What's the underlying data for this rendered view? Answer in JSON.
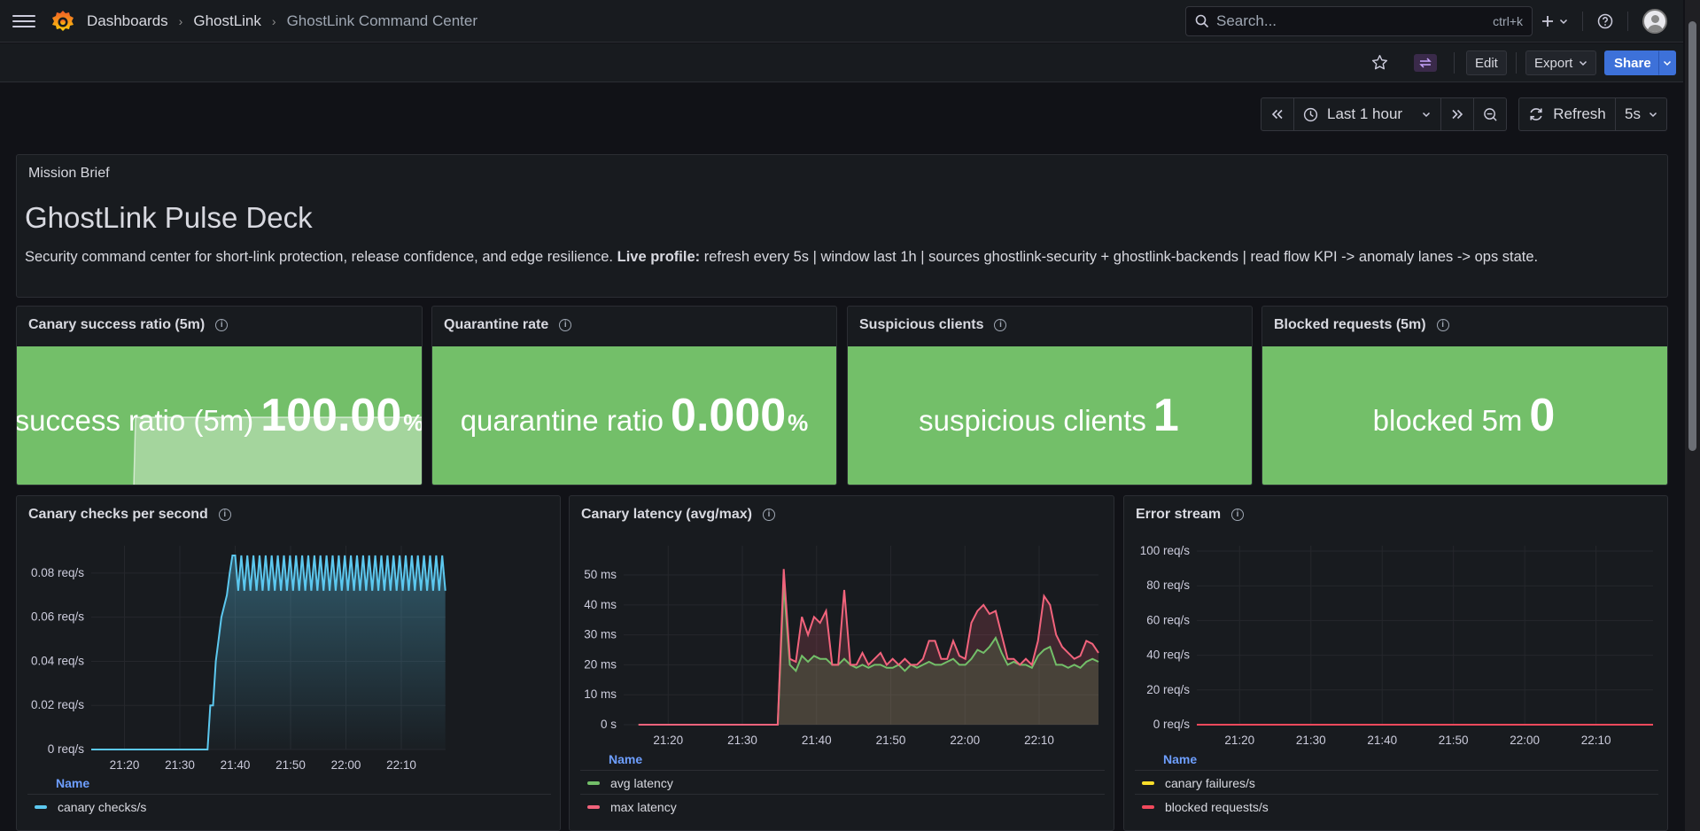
{
  "topbar": {
    "breadcrumbs": [
      "Dashboards",
      "GhostLink",
      "GhostLink Command Center"
    ],
    "search_placeholder": "Search...",
    "search_shortcut": "ctrl+k"
  },
  "toolbar": {
    "edit_label": "Edit",
    "export_label": "Export",
    "share_label": "Share"
  },
  "time_controls": {
    "range_label": "Last 1 hour",
    "refresh_label": "Refresh",
    "interval_label": "5s"
  },
  "mission_brief": {
    "panel_title": "Mission Brief",
    "heading": "GhostLink Pulse Deck",
    "description_start": "Security command center for short-link protection, release confidence, and edge resilience. ",
    "description_bold": "Live profile:",
    "description_end": " refresh every 5s | window last 1h | sources ghostlink-security + ghostlink-backends | read flow KPI -> anomaly lanes -> ops state."
  },
  "stats": [
    {
      "title": "Canary success ratio (5m)",
      "label": "success ratio (5m)",
      "value": "100.00",
      "unit": "%",
      "color": "#73bf69"
    },
    {
      "title": "Quarantine rate",
      "label": "quarantine ratio",
      "value": "0.000",
      "unit": "%",
      "color": "#73bf69"
    },
    {
      "title": "Suspicious clients",
      "label": "suspicious clients",
      "value": "1",
      "unit": "",
      "color": "#73bf69"
    },
    {
      "title": "Blocked requests (5m)",
      "label": "blocked 5m",
      "value": "0",
      "unit": "",
      "color": "#73bf69"
    }
  ],
  "charts": {
    "checks": {
      "title": "Canary checks per second",
      "legend_header": "Name",
      "legend": [
        {
          "name": "canary checks/s",
          "color": "#5cc8ef"
        }
      ]
    },
    "latency": {
      "title": "Canary latency (avg/max)",
      "legend_header": "Name",
      "legend": [
        {
          "name": "avg latency",
          "color": "#73bf69"
        },
        {
          "name": "max latency",
          "color": "#f2637c"
        }
      ]
    },
    "errors": {
      "title": "Error stream",
      "legend_header": "Name",
      "legend": [
        {
          "name": "canary failures/s",
          "color": "#fade2a"
        },
        {
          "name": "blocked requests/s",
          "color": "#f2495c"
        }
      ]
    }
  },
  "chart_data": [
    {
      "type": "line",
      "title": "Canary checks per second",
      "x_ticks": [
        "21:20",
        "21:30",
        "21:40",
        "21:50",
        "22:00",
        "22:10"
      ],
      "y_ticks": [
        "0 req/s",
        "0.02 req/s",
        "0.04 req/s",
        "0.06 req/s",
        "0.08 req/s"
      ],
      "ylim": [
        0,
        0.09
      ],
      "series": [
        {
          "name": "canary checks/s",
          "color": "#5cc8ef",
          "description_points": [
            [
              "21:14",
              0
            ],
            [
              "21:35",
              0
            ],
            [
              "21:35.5",
              0.02
            ],
            [
              "21:36",
              0.02
            ],
            [
              "21:36.5",
              0.04
            ],
            [
              "21:37",
              0.05
            ],
            [
              "21:37.5",
              0.06
            ],
            [
              "21:38",
              0.065
            ],
            [
              "21:38.5",
              0.07
            ],
            [
              "21:39",
              0.08
            ],
            [
              "21:39.5",
              0.088
            ],
            [
              "22:18",
              0.08
            ]
          ],
          "oscillation": {
            "from": "21:40",
            "to": "22:18",
            "low": 0.072,
            "high": 0.088
          }
        }
      ]
    },
    {
      "type": "line",
      "title": "Canary latency (avg/max)",
      "x_ticks": [
        "21:20",
        "21:30",
        "21:40",
        "21:50",
        "22:00",
        "22:10"
      ],
      "y_ticks": [
        "0 s",
        "10 ms",
        "20 ms",
        "30 ms",
        "40 ms",
        "50 ms"
      ],
      "ylim": [
        0,
        58
      ],
      "series": [
        {
          "name": "avg latency",
          "color": "#73bf69",
          "values": [
            0,
            0,
            0,
            0,
            0,
            0,
            0,
            0,
            0,
            0,
            0,
            0,
            0,
            0,
            0,
            0,
            0,
            0,
            0,
            0,
            0,
            0,
            0,
            0,
            47,
            20,
            18,
            23,
            21,
            23,
            22,
            22,
            20,
            20,
            22,
            20,
            19,
            20,
            19,
            20,
            20,
            19,
            19,
            20,
            18,
            20,
            19,
            20,
            21,
            20,
            20,
            21,
            22,
            20,
            20,
            22,
            25,
            24,
            26,
            29,
            24,
            20,
            21,
            20,
            20,
            19,
            23,
            25,
            26,
            20,
            20,
            19,
            20,
            19,
            21,
            22,
            21
          ]
        },
        {
          "name": "max latency",
          "color": "#f2637c",
          "values": [
            0,
            0,
            0,
            0,
            0,
            0,
            0,
            0,
            0,
            0,
            0,
            0,
            0,
            0,
            0,
            0,
            0,
            0,
            0,
            0,
            0,
            0,
            0,
            0,
            52,
            22,
            21,
            36,
            30,
            36,
            34,
            38,
            20,
            20,
            45,
            20,
            20,
            24,
            20,
            22,
            24,
            20,
            22,
            20,
            22,
            20,
            20,
            22,
            28,
            28,
            22,
            22,
            28,
            23,
            22,
            34,
            38,
            40,
            37,
            38,
            30,
            22,
            22,
            20,
            22,
            20,
            28,
            43,
            40,
            30,
            26,
            24,
            22,
            23,
            28,
            27,
            24
          ]
        }
      ]
    },
    {
      "type": "line",
      "title": "Error stream",
      "x_ticks": [
        "21:20",
        "21:30",
        "21:40",
        "21:50",
        "22:00",
        "22:10"
      ],
      "y_ticks": [
        "0 req/s",
        "20 req/s",
        "40 req/s",
        "60 req/s",
        "80 req/s",
        "100 req/s"
      ],
      "ylim": [
        0,
        100
      ],
      "series": [
        {
          "name": "canary failures/s",
          "color": "#fade2a",
          "constant": 0
        },
        {
          "name": "blocked requests/s",
          "color": "#f2495c",
          "constant": 0
        }
      ]
    }
  ]
}
